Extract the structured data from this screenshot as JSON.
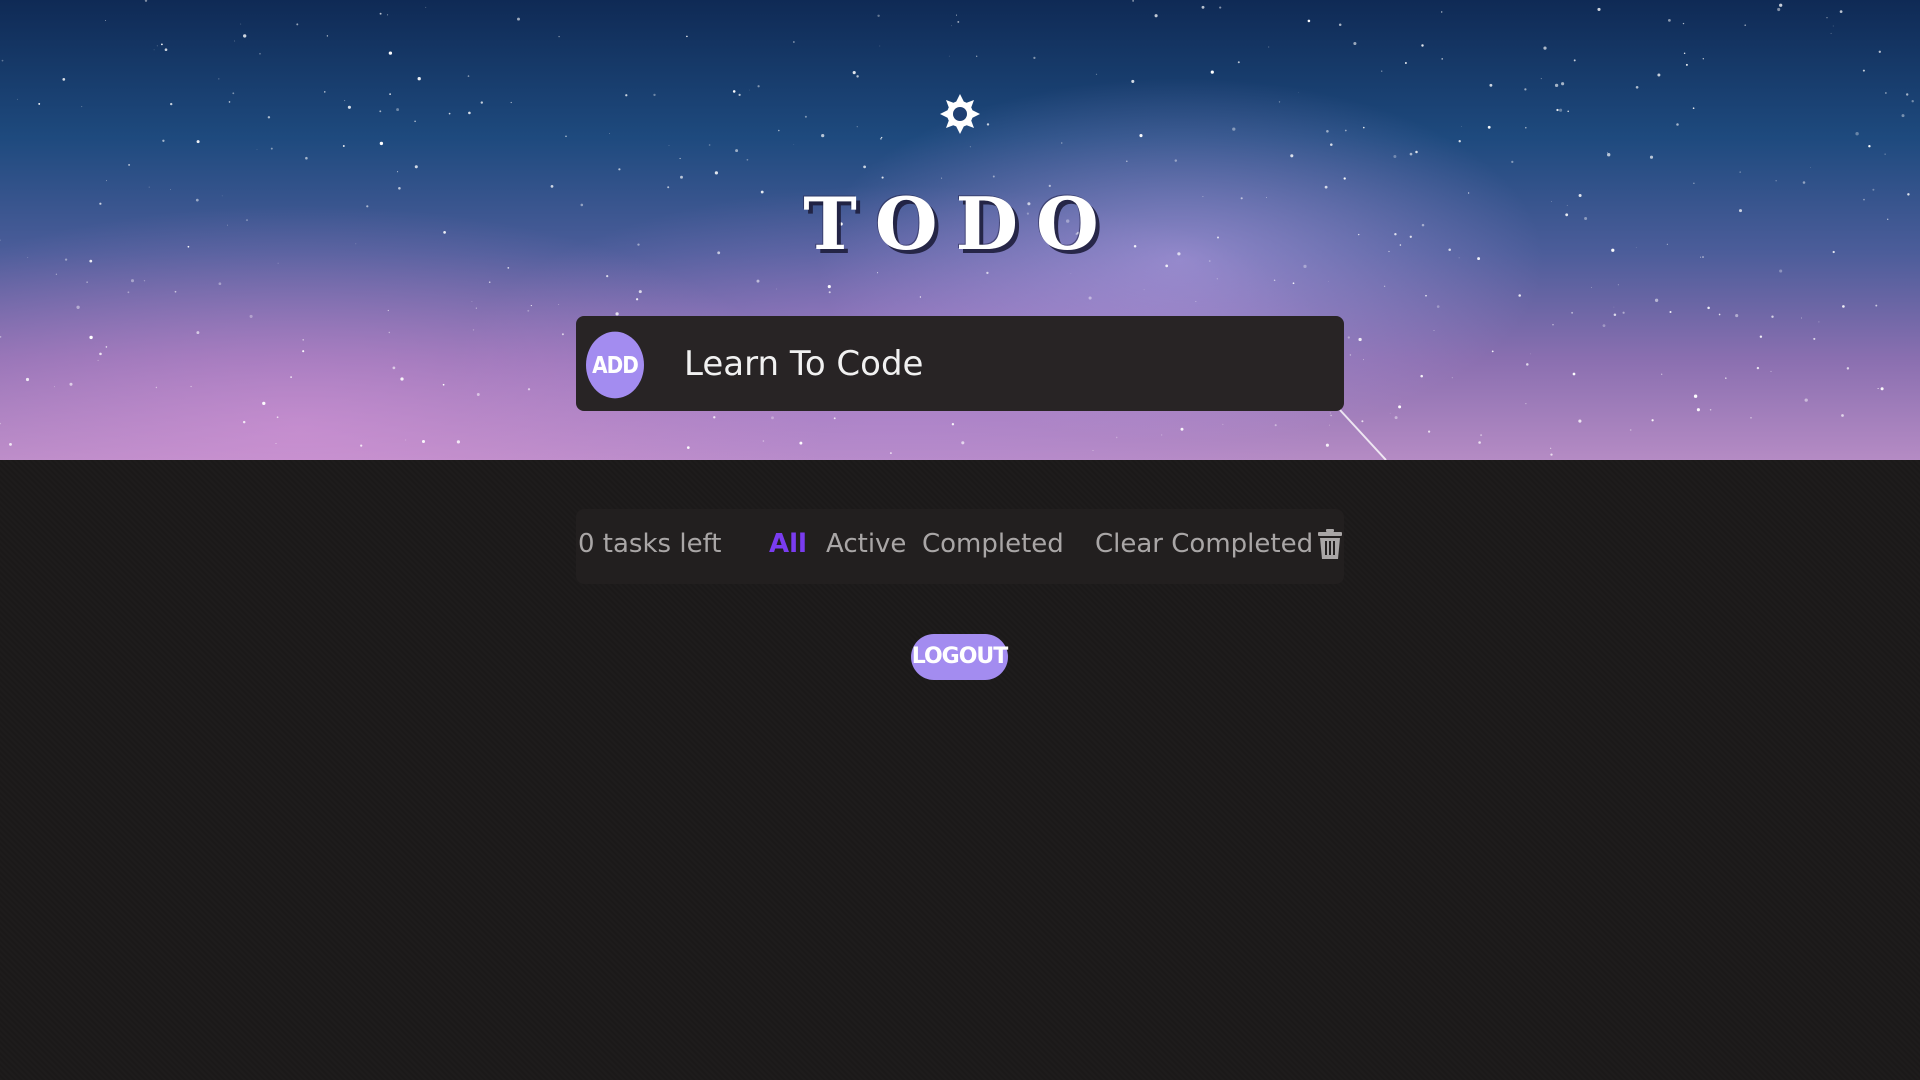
{
  "header": {
    "theme_toggle_icon": "sun-icon",
    "title": "TODO"
  },
  "todo_input": {
    "add_label": "ADD",
    "value": "Learn To Code"
  },
  "filters": {
    "tasks_left": "0 tasks left",
    "all": "All",
    "active": "Active",
    "completed": "Completed",
    "selected": "All",
    "clear_completed": "Clear Completed",
    "clear_icon": "trash-icon"
  },
  "logout_label": "LOGOUT",
  "colors": {
    "accent": "#a38cf0",
    "active_filter": "#7a3cf0",
    "panel": "#282425",
    "background": "#1b1919"
  }
}
